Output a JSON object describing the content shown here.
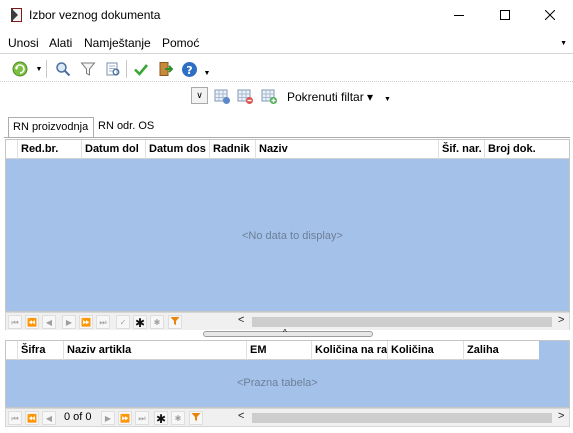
{
  "window": {
    "title": "Izbor veznog dokumenta"
  },
  "menu": {
    "items": [
      "Unosi",
      "Alati",
      "Namještanje",
      "Pomoć"
    ]
  },
  "toolbar2": {
    "filter_label": "Pokrenuti filtar ▾"
  },
  "tabs": [
    "RN proizvodnja",
    "RN odr. OS"
  ],
  "main_grid": {
    "columns": [
      "Red.br.",
      "Datum dol",
      "Datum dos",
      "Radnik",
      "Naziv",
      "Šif. nar.",
      "Broj dok."
    ],
    "empty_text": "<No data to display>"
  },
  "detail_grid": {
    "columns": [
      "Šifra",
      "Naziv artikla",
      "EM",
      "Količina na ra",
      "Količina",
      "Zaliha"
    ],
    "empty_text": "<Prazna tabela>",
    "record_counter": "0 of 0"
  },
  "colors": {
    "grid_bg": "#a3c1e9",
    "filter_icon": "#e8830c",
    "check_icon": "#3aa635"
  },
  "icons": [
    "app-book-icon",
    "refresh-icon",
    "search-icon",
    "filter-icon",
    "find-list-icon",
    "check-icon",
    "exit-icon",
    "help-icon",
    "collapse-icon",
    "table-add-icon",
    "table-delete-icon",
    "table-add2-icon"
  ]
}
